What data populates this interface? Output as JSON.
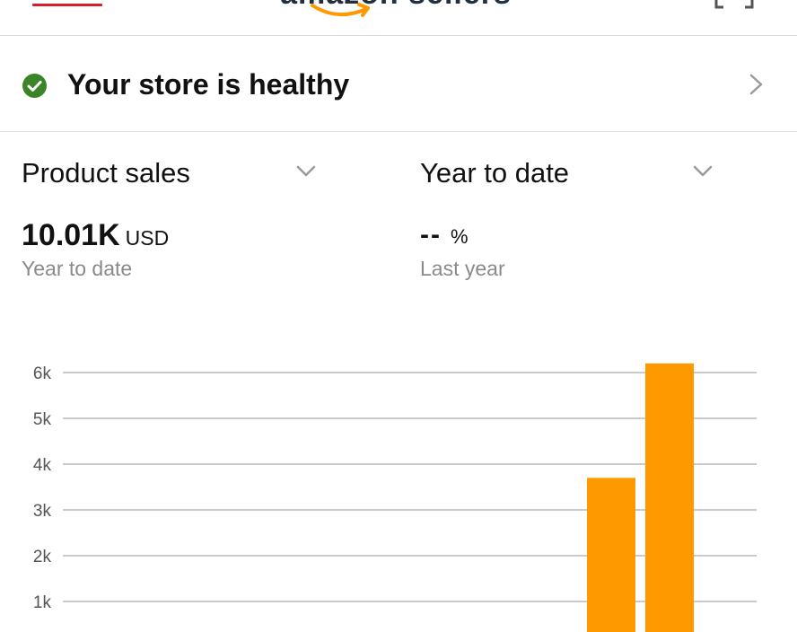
{
  "header": {
    "menu_icon": "hamburger-menu-icon",
    "logo_text": "amazon sellers",
    "logo_accent": "#ff9900",
    "scan_icon": "scan-icon"
  },
  "health": {
    "status_text": "Your store is healthy",
    "status_color": "#3b8427",
    "icon": "check-circle-icon"
  },
  "metrics": {
    "left": {
      "selector_label": "Product sales",
      "value": "10.01K",
      "unit": "USD",
      "subtitle": "Year to date"
    },
    "right": {
      "selector_label": "Year to date",
      "value": "--",
      "unit": "%",
      "subtitle": "Last year"
    }
  },
  "chart_data": {
    "type": "bar",
    "ytick_labels": [
      "1k",
      "2k",
      "3k",
      "4k",
      "5k",
      "6k"
    ],
    "y_ticks": [
      1000,
      2000,
      3000,
      4000,
      5000,
      6000
    ],
    "ylim": [
      0,
      6300
    ],
    "values": [
      0,
      0,
      0,
      0,
      0,
      0,
      0,
      0,
      0,
      3700,
      6200
    ],
    "bar_color": "#ff9900",
    "grid": true
  }
}
